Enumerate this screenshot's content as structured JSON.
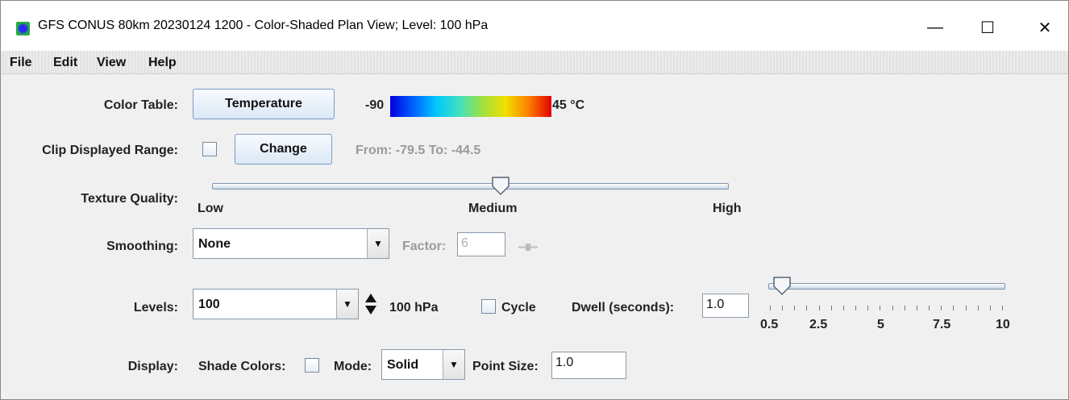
{
  "window": {
    "title": "GFS CONUS 80km 20230124 1200 - Color-Shaded Plan View; Level: 100 hPa",
    "minimize": "—",
    "maximize": "☐",
    "close": "✕"
  },
  "menu": [
    "File",
    "Edit",
    "View",
    "Help"
  ],
  "color_table": {
    "label": "Color Table:",
    "button": "Temperature",
    "min": "-90",
    "max": "45 °C",
    "gradient_colors": [
      "#0000e0",
      "#0060ff",
      "#00c8ff",
      "#40e0c0",
      "#a0e040",
      "#f0e000",
      "#ff8000",
      "#e00000"
    ]
  },
  "clip": {
    "label": "Clip Displayed Range:",
    "checked": false,
    "button": "Change",
    "range_text": "From: -79.5 To: -44.5"
  },
  "texture": {
    "label": "Texture Quality:",
    "low": "Low",
    "medium": "Medium",
    "high": "High",
    "value_fraction": 0.56
  },
  "smoothing": {
    "label": "Smoothing:",
    "value": "None",
    "factor_label": "Factor:",
    "factor_value": "6"
  },
  "levels": {
    "label": "Levels:",
    "value": "100",
    "unit_text": "100 hPa",
    "cycle_label": "Cycle",
    "cycle_checked": false,
    "dwell_label": "Dwell (seconds):",
    "dwell_value": "1.0",
    "dwell_ticks": [
      "0.5",
      "2.5",
      "5",
      "7.5",
      "10"
    ],
    "dwell_slider_value": 1.0
  },
  "display": {
    "label": "Display:",
    "shade_label": "Shade Colors:",
    "shade_checked": false,
    "mode_label": "Mode:",
    "mode_value": "Solid",
    "point_size_label": "Point Size:",
    "point_size_value": "1.0"
  }
}
